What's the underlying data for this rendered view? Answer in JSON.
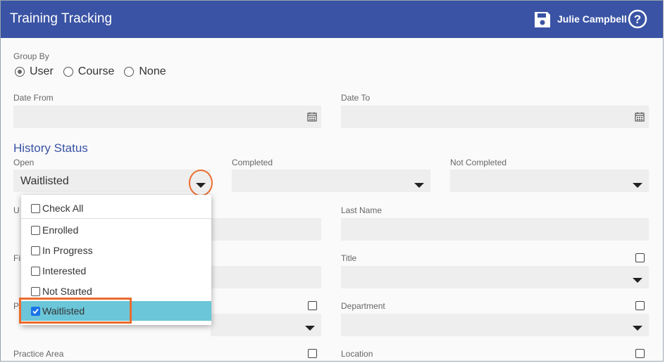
{
  "header": {
    "title": "Training Tracking",
    "save_icon": "save-icon",
    "user_name": "Julie Campbell",
    "help_icon": "help-icon"
  },
  "group_by": {
    "label": "Group By",
    "options": [
      "User",
      "Course",
      "None"
    ],
    "selected": "User"
  },
  "dates": {
    "from_label": "Date From",
    "from_value": "",
    "to_label": "Date To",
    "to_value": ""
  },
  "history_status": {
    "title": "History Status",
    "open_label": "Open",
    "open_value": "Waitlisted",
    "completed_label": "Completed",
    "not_completed_label": "Not Completed"
  },
  "dropdown": {
    "check_all": "Check All",
    "items": [
      {
        "label": "Enrolled",
        "checked": false
      },
      {
        "label": "In Progress",
        "checked": false
      },
      {
        "label": "Interested",
        "checked": false
      },
      {
        "label": "Not Started",
        "checked": false
      },
      {
        "label": "Waitlisted",
        "checked": true
      }
    ]
  },
  "fields": {
    "partial_u": "U",
    "last_name_label": "Last Name",
    "partial_fi": "Fi",
    "title_label": "Title",
    "partial_p": "P",
    "department_label": "Department",
    "practice_area_label": "Practice Area",
    "location_label": "Location"
  },
  "colors": {
    "header_bg": "#3a53a4",
    "accent_title": "#3a53a4",
    "selected_item_bg": "#6ac6d8",
    "highlight_orange": "#ec6b2d"
  }
}
